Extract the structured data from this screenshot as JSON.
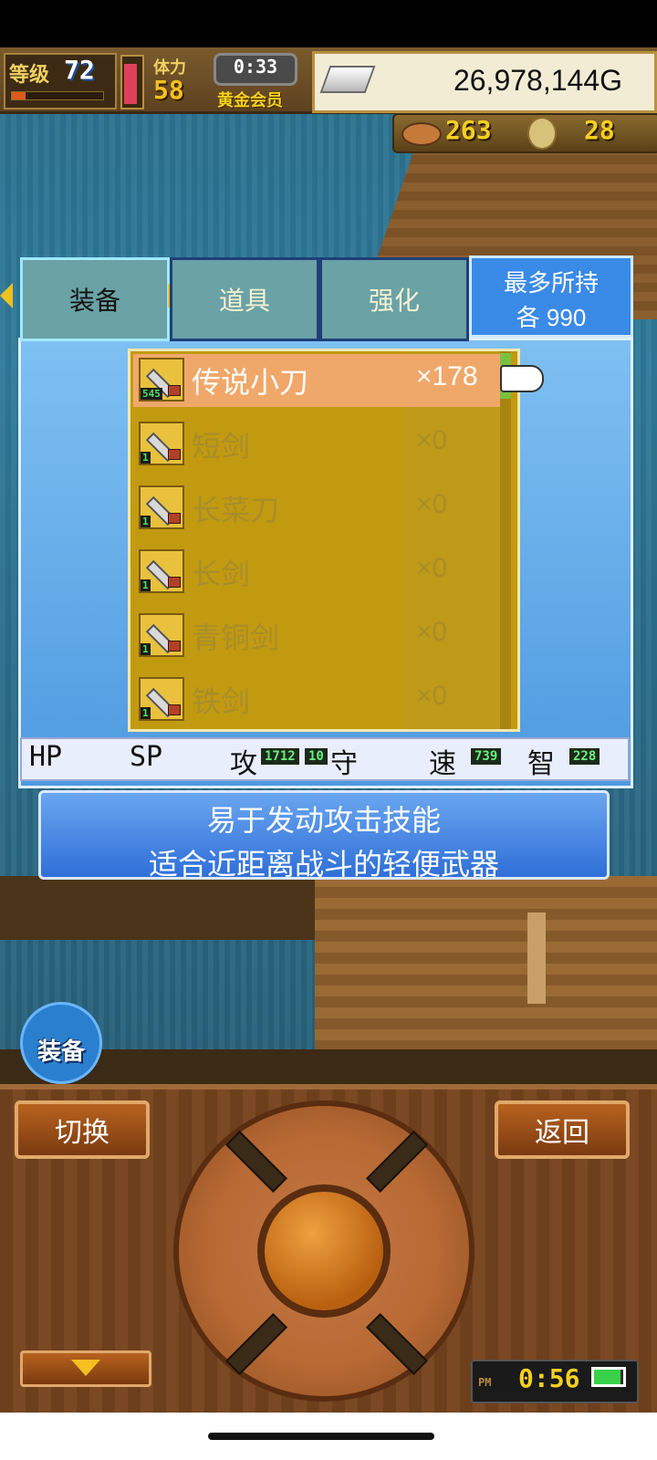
{
  "status": {
    "level_label": "等级",
    "level": "72",
    "level_progress": 0.15,
    "hp_fill": 0.85,
    "stat_label": "体力",
    "stat_value": "58",
    "timer": "0:33",
    "membership": "黄金会员",
    "gold": "26,978,144G"
  },
  "resources": {
    "food_icon": "meat-icon",
    "food_count": "263",
    "coin_icon": "medal-icon",
    "coin_count": "28"
  },
  "tabs": [
    {
      "label": "装备",
      "selected": true
    },
    {
      "label": "道具",
      "selected": false
    },
    {
      "label": "强化",
      "selected": false
    }
  ],
  "capacity": {
    "line1": "最多所持",
    "line2": "各 990"
  },
  "items": [
    {
      "name": "传说小刀",
      "qty": "×178",
      "lv": "545",
      "selected": true
    },
    {
      "name": "短剑",
      "qty": "×0",
      "lv": "1",
      "selected": false
    },
    {
      "name": "长菜刀",
      "qty": "×0",
      "lv": "1",
      "selected": false
    },
    {
      "name": "长剑",
      "qty": "×0",
      "lv": "1",
      "selected": false
    },
    {
      "name": "青铜剑",
      "qty": "×0",
      "lv": "1",
      "selected": false
    },
    {
      "name": "铁剑",
      "qty": "×0",
      "lv": "1",
      "selected": false
    }
  ],
  "stats": {
    "hp_label": "HP",
    "sp_label": "SP",
    "atk_label": "攻",
    "atk_value": "1712",
    "def_label": "守",
    "def_value": "10",
    "spd_label": "速",
    "spd_value": "739",
    "int_label": "智",
    "int_value": "228"
  },
  "description": {
    "line1": "易于发动攻击技能",
    "line2": "适合近距离战斗的轻便武器"
  },
  "equip_bubble_label": "装备",
  "controls": {
    "switch_label": "切换",
    "back_label": "返回"
  },
  "clock": {
    "ampm": "PM",
    "time": "0:56",
    "battery": 0.9
  },
  "colors": {
    "panel_blue": "#4e9ae0",
    "list_gold": "#c29a10",
    "selected_row": "#f0a86a",
    "wood": "#6e3f1c"
  }
}
